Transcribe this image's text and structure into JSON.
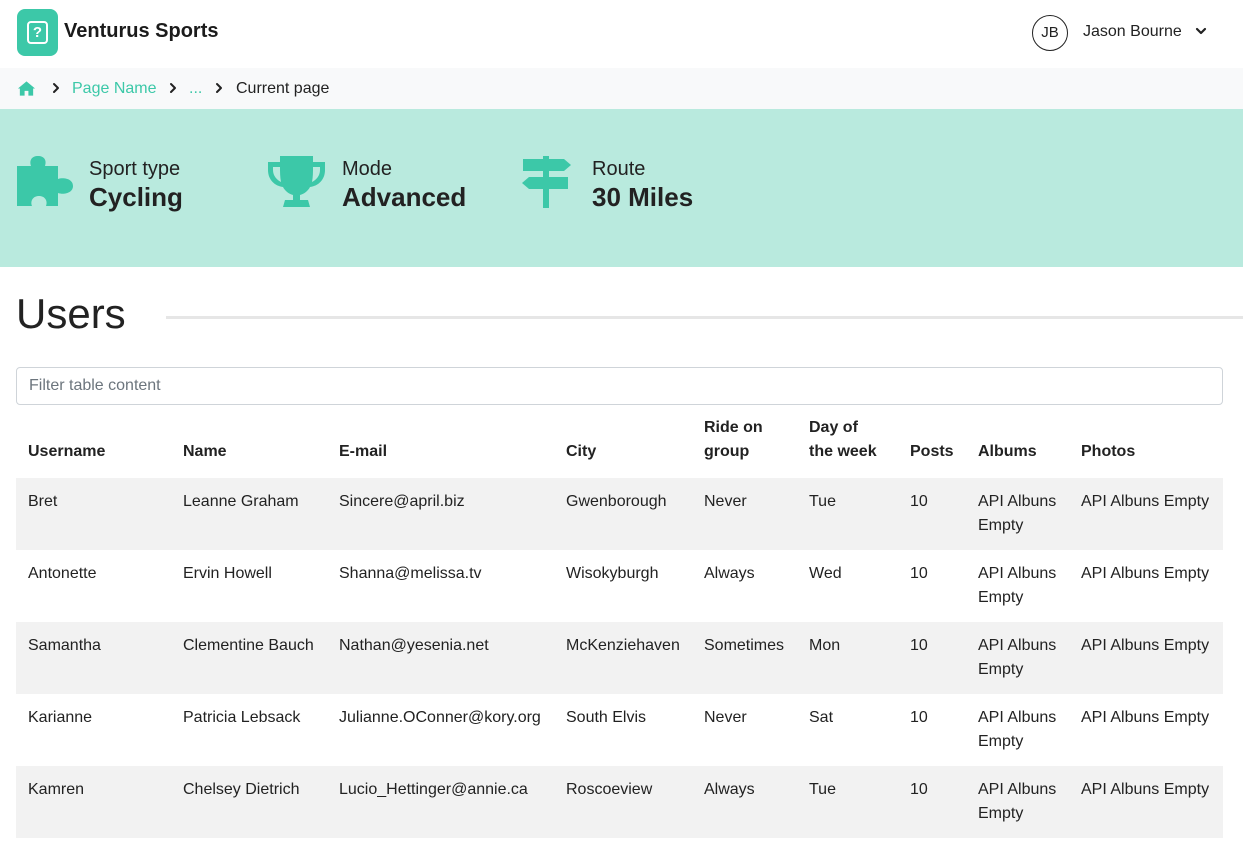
{
  "app": {
    "brand": "Venturus Sports",
    "logo_icon": "question-square-icon"
  },
  "user": {
    "initials": "JB",
    "name": "Jason Bourne"
  },
  "breadcrumb": {
    "items": [
      "Page Name",
      "..."
    ],
    "current": "Current page"
  },
  "stats": [
    {
      "label": "Sport type",
      "value": "Cycling",
      "icon": "puzzle-piece-icon"
    },
    {
      "label": "Mode",
      "value": "Advanced",
      "icon": "trophy-icon"
    },
    {
      "label": "Route",
      "value": "30 Miles",
      "icon": "signpost-icon"
    }
  ],
  "section": {
    "title": "Users"
  },
  "filter": {
    "placeholder": "Filter table content"
  },
  "table": {
    "headers": [
      "Username",
      "Name",
      "E-mail",
      "City",
      "Ride on group",
      "Day of the week",
      "Posts",
      "Albums",
      "Photos"
    ],
    "rows": [
      {
        "username": "Bret",
        "name": "Leanne Graham",
        "email": "Sincere@april.biz",
        "city": "Gwenborough",
        "ride": "Never",
        "day": "Tue",
        "posts": "10",
        "albums": "API Albuns Empty",
        "photos": "API Albuns Empty"
      },
      {
        "username": "Antonette",
        "name": "Ervin Howell",
        "email": "Shanna@melissa.tv",
        "city": "Wisokyburgh",
        "ride": "Always",
        "day": "Wed",
        "posts": "10",
        "albums": "API Albuns Empty",
        "photos": "API Albuns Empty"
      },
      {
        "username": "Samantha",
        "name": "Clementine Bauch",
        "email": "Nathan@yesenia.net",
        "city": "McKenziehaven",
        "ride": "Sometimes",
        "day": "Mon",
        "posts": "10",
        "albums": "API Albuns Empty",
        "photos": "API Albuns Empty"
      },
      {
        "username": "Karianne",
        "name": "Patricia Lebsack",
        "email": "Julianne.OConner@kory.org",
        "city": "South Elvis",
        "ride": "Never",
        "day": "Sat",
        "posts": "10",
        "albums": "API Albuns Empty",
        "photos": "API Albuns Empty"
      },
      {
        "username": "Kamren",
        "name": "Chelsey Dietrich",
        "email": "Lucio_Hettinger@annie.ca",
        "city": "Roscoeview",
        "ride": "Always",
        "day": "Tue",
        "posts": "10",
        "albums": "API Albuns Empty",
        "photos": "API Albuns Empty"
      }
    ]
  },
  "colors": {
    "accent": "#3cc8a8",
    "hero_bg": "#b9eade",
    "row_stripe": "#f2f2f2",
    "breadcrumb_bg": "#f8f9fa"
  }
}
